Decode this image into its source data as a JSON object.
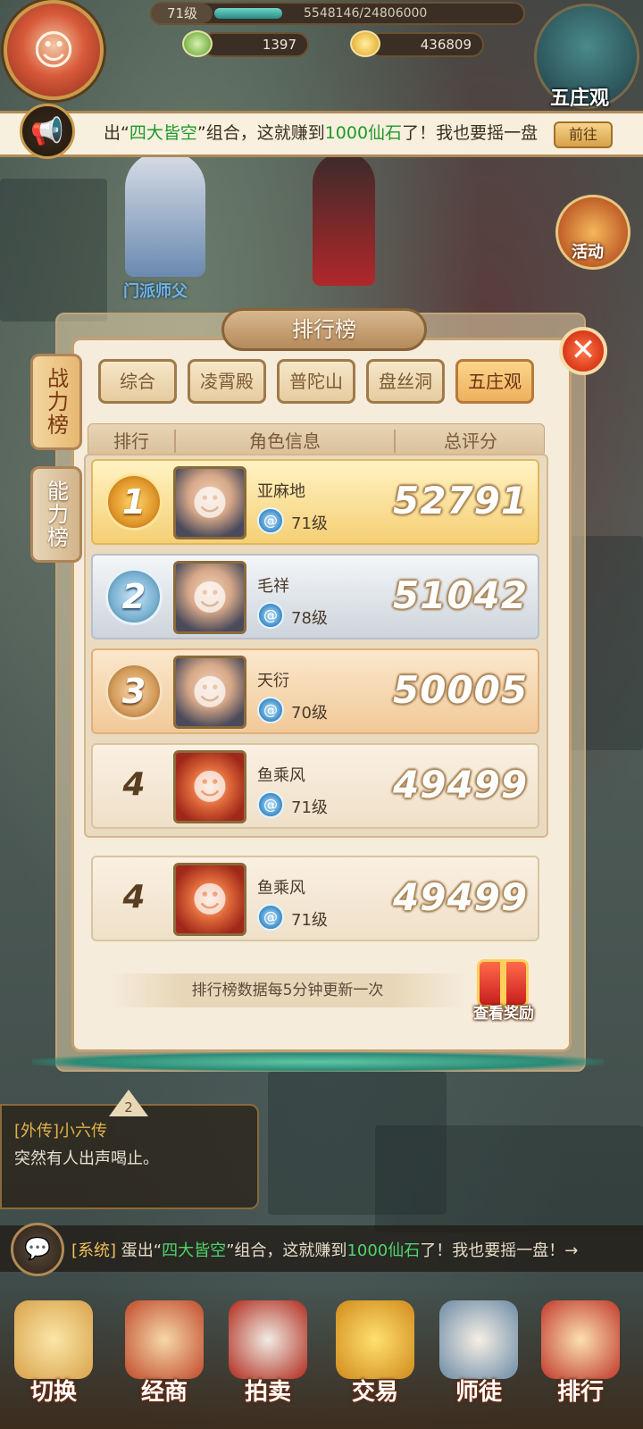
{
  "hud": {
    "level": "71级",
    "exp": "5548146/24806000",
    "exp_fraction": 0.224,
    "currency_silver": "1397",
    "currency_gold": "436809",
    "map_name": "五庄观"
  },
  "announce": {
    "prefix": "出“",
    "highlight": "四大皆空",
    "mid": "”组合，这就赚到",
    "amount": "1000仙石",
    "suffix": "了！我也要摇一盘",
    "go_label": "前往"
  },
  "npc": {
    "label": "门派师父"
  },
  "side": {
    "activity_label": "活动"
  },
  "panel": {
    "title": "排行榜",
    "close": "✕",
    "vtabs": [
      "战力榜",
      "能力榜"
    ],
    "tabs": [
      "综合",
      "凌霄殿",
      "普陀山",
      "盘丝洞",
      "五庄观"
    ],
    "active_tab": 4,
    "headers": {
      "rank": "排行",
      "info": "角色信息",
      "score": "总评分"
    },
    "rows": [
      {
        "rank": "1",
        "name": "亚麻地",
        "level": "71级",
        "score": "52791"
      },
      {
        "rank": "2",
        "name": "毛祥",
        "level": "78级",
        "score": "51042"
      },
      {
        "rank": "3",
        "name": "天衍",
        "level": "70级",
        "score": "50005"
      },
      {
        "rank": "4",
        "name": "鱼乘风",
        "level": "71级",
        "score": "49499"
      }
    ],
    "self_row": {
      "rank": "4",
      "name": "鱼乘风",
      "level": "71级",
      "score": "49499"
    },
    "update_note": "排行榜数据每5分钟更新一次",
    "reward_label": "查看奖励"
  },
  "quest": {
    "badge": "2",
    "title": "[外传]小六传",
    "desc": "突然有人出声喝止。"
  },
  "chat": {
    "channel": "[系统]",
    "pre": "蛋出“",
    "highlight": "四大皆空",
    "mid": "”组合，这就赚到",
    "amount": "1000仙石",
    "suffix": "了！我也要摇一盘！→"
  },
  "nav": {
    "items": [
      "切换",
      "经商",
      "拍卖",
      "交易",
      "师徒",
      "排行"
    ]
  }
}
